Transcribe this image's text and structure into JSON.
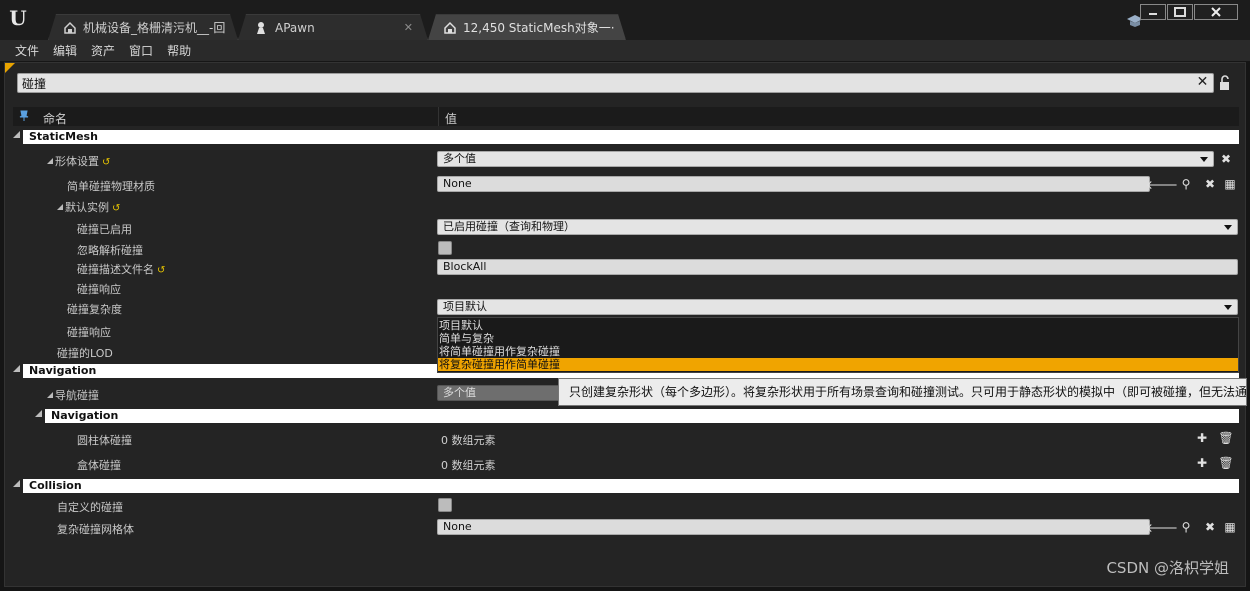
{
  "tabs": [
    {
      "label": "机械设备_格栅清污机__-回",
      "icon": "blueprint-icon"
    },
    {
      "label": "APawn",
      "icon": "pawn-icon"
    },
    {
      "label": "12,450 StaticMesh对象一·",
      "icon": "blueprint-icon"
    }
  ],
  "menu": [
    "文件",
    "编辑",
    "资产",
    "窗口",
    "帮助"
  ],
  "search": {
    "value": "碰撞"
  },
  "header": {
    "name": "命名",
    "value": "值"
  },
  "categories": {
    "staticmesh": "StaticMesh",
    "navigation": "Navigation",
    "navigation_sub": "Navigation",
    "collision": "Collision"
  },
  "rows": {
    "body_setup": {
      "label": "形体设置",
      "value": "多个值"
    },
    "simple_phys_material": {
      "label": "简单碰撞物理材质",
      "value": "None"
    },
    "default_instance": {
      "label": "默认实例"
    },
    "collision_enabled": {
      "label": "碰撞已启用",
      "value": "已启用碰撞（查询和物理）"
    },
    "ignore_analytic": {
      "label": "忽略解析碰撞"
    },
    "collision_profile": {
      "label": "碰撞描述文件名",
      "value": "BlockAll"
    },
    "collision_response": {
      "label": "碰撞响应"
    },
    "collision_complexity": {
      "label": "碰撞复杂度",
      "value": "项目默认"
    },
    "collision_response2": {
      "label": "碰撞响应"
    },
    "lod_for_collision": {
      "label": "碰撞的LOD"
    },
    "nav_collision": {
      "label": "导航碰撞",
      "value": "多个值"
    },
    "cylinder_collision": {
      "label": "圆柱体碰撞",
      "value": "0 数组元素"
    },
    "box_collision": {
      "label": "盒体碰撞",
      "value": "0 数组元素"
    },
    "custom_collision": {
      "label": "自定义的碰撞"
    },
    "complex_collision_mesh": {
      "label": "复杂碰撞网格体",
      "value": "None"
    }
  },
  "dropdown_options": [
    "项目默认",
    "简单与复杂",
    "将简单碰撞用作复杂碰撞",
    "将复杂碰撞用作简单碰撞"
  ],
  "dropdown_selected_index": 3,
  "tooltip": "只创建复杂形状（每个多边形）。将复杂形状用于所有场景查询和碰撞测试。只可用于静态形状的模拟中（即可被碰撞，但无法通",
  "watermark": "CSDN @洛枳学姐",
  "colors": {
    "accent": "#f0a400",
    "reset_arrow": "#e8c500"
  }
}
